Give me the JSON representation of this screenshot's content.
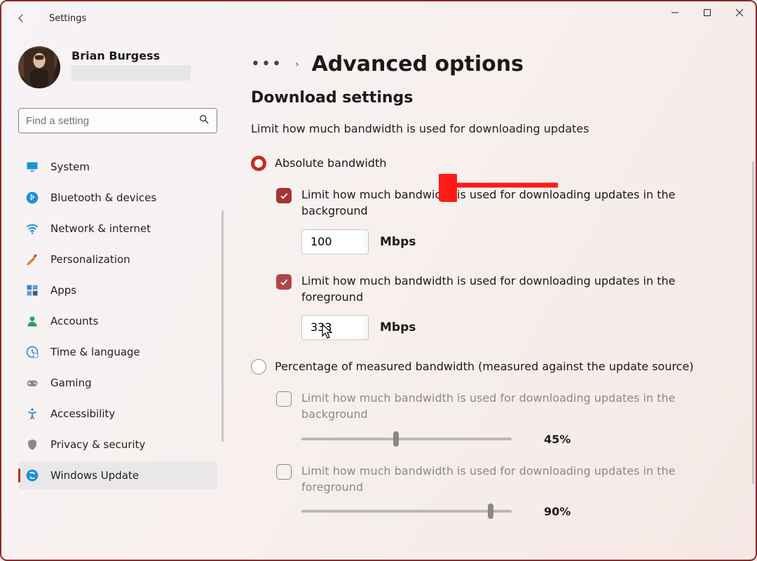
{
  "app_title": "Settings",
  "user": {
    "name": "Brian Burgess"
  },
  "search": {
    "placeholder": "Find a setting"
  },
  "nav": [
    {
      "id": "system",
      "label": "System",
      "icon": "monitor",
      "color": "#1e90d6"
    },
    {
      "id": "bluetooth",
      "label": "Bluetooth & devices",
      "icon": "bluetooth",
      "color": "#1e90d6"
    },
    {
      "id": "network",
      "label": "Network & internet",
      "icon": "wifi",
      "color": "#1e90d6"
    },
    {
      "id": "personalization",
      "label": "Personalization",
      "icon": "brush",
      "color": "#d08a30"
    },
    {
      "id": "apps",
      "label": "Apps",
      "icon": "apps",
      "color": "#4a7dc0"
    },
    {
      "id": "accounts",
      "label": "Accounts",
      "icon": "person",
      "color": "#2aa05a"
    },
    {
      "id": "time",
      "label": "Time & language",
      "icon": "clock",
      "color": "#3a8dc0"
    },
    {
      "id": "gaming",
      "label": "Gaming",
      "icon": "gamepad",
      "color": "#888"
    },
    {
      "id": "accessibility",
      "label": "Accessibility",
      "icon": "accessibility",
      "color": "#2a78c0"
    },
    {
      "id": "privacy",
      "label": "Privacy & security",
      "icon": "shield",
      "color": "#888"
    },
    {
      "id": "windows-update",
      "label": "Windows Update",
      "icon": "refresh",
      "color": "#1e90d6",
      "active": true
    }
  ],
  "breadcrumb": {
    "more": "…",
    "chevron": "›",
    "title": "Advanced options"
  },
  "section": {
    "heading": "Download settings",
    "subheading": "Limit how much bandwidth is used for downloading updates"
  },
  "bandwidth": {
    "abs_label": "Absolute bandwidth",
    "abs_selected": true,
    "bg": {
      "label": "Limit how much bandwidth is used for downloading updates in the background",
      "checked": true,
      "value": "100",
      "unit": "Mbps"
    },
    "fg": {
      "label": "Limit how much bandwidth is used for downloading updates in the foreground",
      "checked": true,
      "value": "333",
      "unit": "Mbps"
    },
    "pct_label": "Percentage of measured bandwidth (measured against the update source)",
    "pct_selected": false,
    "pct_bg": {
      "label": "Limit how much bandwidth is used for downloading updates in the background",
      "checked": false,
      "value_pct": "45%",
      "value_num": 45
    },
    "pct_fg": {
      "label": "Limit how much bandwidth is used for downloading updates in the foreground",
      "checked": false,
      "value_pct": "90%",
      "value_num": 90
    }
  }
}
